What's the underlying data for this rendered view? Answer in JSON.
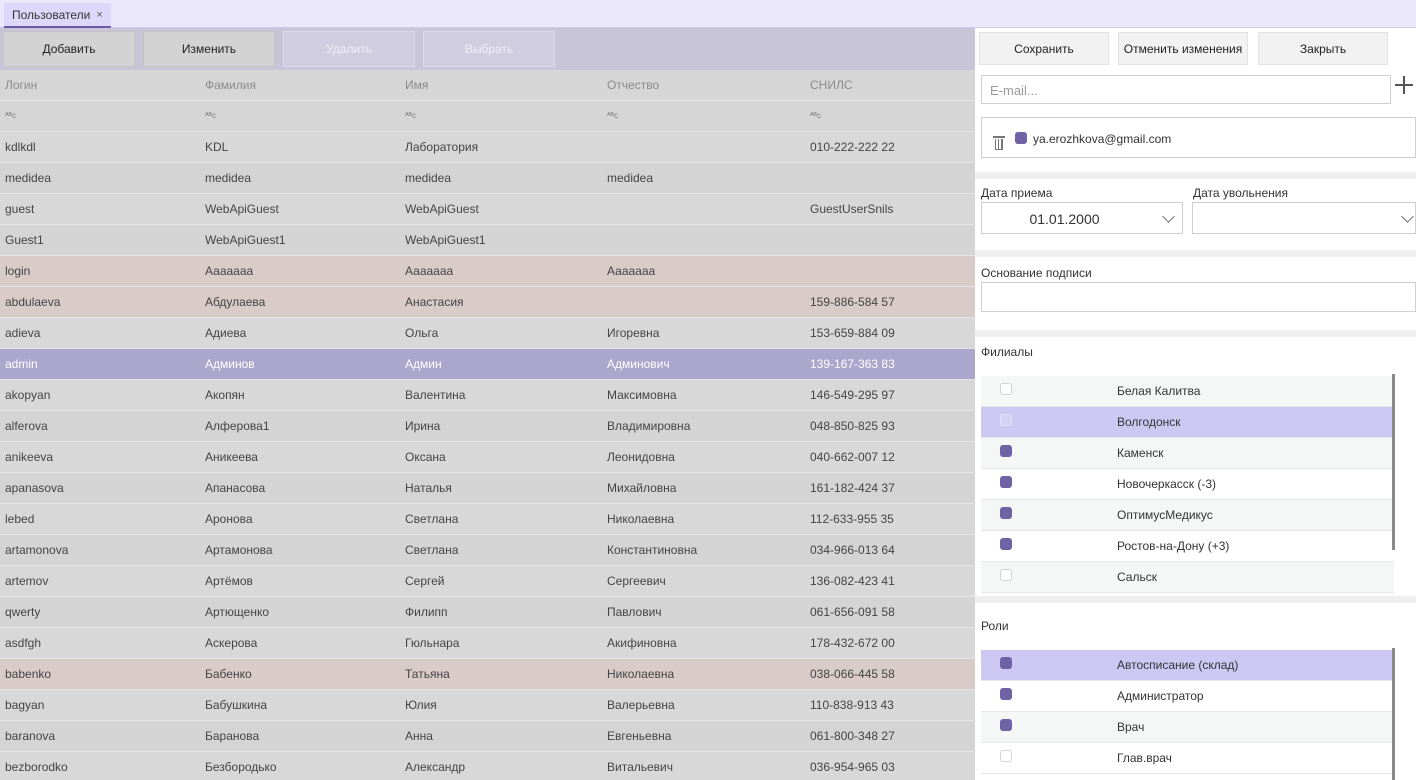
{
  "tab": {
    "label": "Пользователи",
    "close": "×"
  },
  "toolbar": {
    "add": "Добавить",
    "edit": "Изменить",
    "delete": "Удалить",
    "select": "Выбрать"
  },
  "table": {
    "columns": [
      "Логин",
      "Фамилия",
      "Имя",
      "Отчество",
      "СНИЛС"
    ],
    "filter_glyph": "ᴬᴮc",
    "rows": [
      {
        "login": "kdlkdl",
        "last": "KDL",
        "first": "Лаборатория",
        "middle": "",
        "snils": "010-222-222 22",
        "style": "norm"
      },
      {
        "login": "medidea",
        "last": "medidea",
        "first": "medidea",
        "middle": "medidea",
        "snils": "",
        "style": "alt"
      },
      {
        "login": "guest",
        "last": "WebApiGuest",
        "first": "WebApiGuest",
        "middle": "",
        "snils": "GuestUserSnils",
        "style": "norm"
      },
      {
        "login": "Guest1",
        "last": "WebApiGuest1",
        "first": "WebApiGuest1",
        "middle": "",
        "snils": "",
        "style": "alt"
      },
      {
        "login": "login",
        "last": "Ааааааа",
        "first": "Ааааааа",
        "middle": "Ааааааа",
        "snils": "",
        "style": "pink"
      },
      {
        "login": "abdulaeva",
        "last": "Абдулаева",
        "first": "Анастасия",
        "middle": "",
        "snils": "159-886-584 57",
        "style": "pink"
      },
      {
        "login": "adieva",
        "last": "Адиева",
        "first": "Ольга",
        "middle": "Игоревна",
        "snils": "153-659-884 09",
        "style": "norm"
      },
      {
        "login": "admin",
        "last": "Админов",
        "first": "Админ",
        "middle": "Админович",
        "snils": "139-167-363 83",
        "style": "sel"
      },
      {
        "login": "akopyan",
        "last": "Акопян",
        "first": "Валентина",
        "middle": "Максимовна",
        "snils": "146-549-295 97",
        "style": "norm"
      },
      {
        "login": "alferova",
        "last": "Алферова1",
        "first": "Ирина",
        "middle": "Владимировна",
        "snils": "048-850-825 93",
        "style": "alt"
      },
      {
        "login": "anikeeva",
        "last": "Аникеева",
        "first": "Оксана",
        "middle": "Леонидовна",
        "snils": "040-662-007 12",
        "style": "norm"
      },
      {
        "login": "apanasova",
        "last": "Апанасова",
        "first": "Наталья",
        "middle": "Михайловна",
        "snils": "161-182-424 37",
        "style": "alt"
      },
      {
        "login": "lebed",
        "last": "Аронова",
        "first": "Светлана",
        "middle": "Николаевна",
        "snils": "112-633-955 35",
        "style": "norm"
      },
      {
        "login": "artamonova",
        "last": "Артамонова",
        "first": "Светлана",
        "middle": "Константиновна",
        "snils": "034-966-013 64",
        "style": "alt"
      },
      {
        "login": "artemov",
        "last": "Артёмов",
        "first": "Сергей",
        "middle": "Сергеевич",
        "snils": "136-082-423 41",
        "style": "norm"
      },
      {
        "login": "qwerty",
        "last": "Артющенко",
        "first": "Филипп",
        "middle": "Павлович",
        "snils": "061-656-091 58",
        "style": "alt"
      },
      {
        "login": "asdfgh",
        "last": "Аскерова",
        "first": "Гюльнара",
        "middle": "Акифиновна",
        "snils": "178-432-672 00",
        "style": "norm"
      },
      {
        "login": "babenko",
        "last": "Бабенко",
        "first": "Татьяна",
        "middle": "Николаевна",
        "snils": "038-066-445 58",
        "style": "pink"
      },
      {
        "login": "bagyan",
        "last": "Бабушкина",
        "first": "Юлия",
        "middle": "Валерьевна",
        "snils": "110-838-913 43",
        "style": "norm"
      },
      {
        "login": "baranova",
        "last": "Баранова",
        "first": "Анна",
        "middle": "Евгеньевна",
        "snils": "061-800-348 27",
        "style": "alt"
      },
      {
        "login": "bezborodko",
        "last": "Безбородько",
        "first": "Александр",
        "middle": "Витальевич",
        "snils": "036-954-965 03",
        "style": "norm"
      }
    ]
  },
  "panel": {
    "save": "Сохранить",
    "cancel": "Отменить изменения",
    "close": "Закрыть",
    "email_placeholder": "E-mail...",
    "email_value": "ya.erozhkova@gmail.com",
    "hire_date_label": "Дата приема",
    "hire_date_value": "01.01.2000",
    "fire_date_label": "Дата увольнения",
    "fire_date_value": "",
    "signature_label": "Основание подписи",
    "branches_label": "Филиалы",
    "branches": [
      {
        "name": "Белая Калитва",
        "checked": false
      },
      {
        "name": "Волгодонск",
        "checked": false
      },
      {
        "name": "Каменск",
        "checked": true
      },
      {
        "name": "Новочеркасск (-3)",
        "checked": true
      },
      {
        "name": "ОптимусМедикус",
        "checked": true
      },
      {
        "name": "Ростов-на-Дону (+3)",
        "checked": true
      },
      {
        "name": "Сальск",
        "checked": false
      }
    ],
    "roles_label": "Роли",
    "roles": [
      {
        "name": "Автосписание (склад)",
        "checked": true
      },
      {
        "name": "Администратор",
        "checked": true
      },
      {
        "name": "Врач",
        "checked": true
      },
      {
        "name": "Глав.врач",
        "checked": false
      }
    ]
  },
  "colors": {
    "accent": "#6f63a6",
    "selected_row": "#aba6cc",
    "highlight_list": "#cdc8f3",
    "pink_row": "#d9cbc8"
  }
}
